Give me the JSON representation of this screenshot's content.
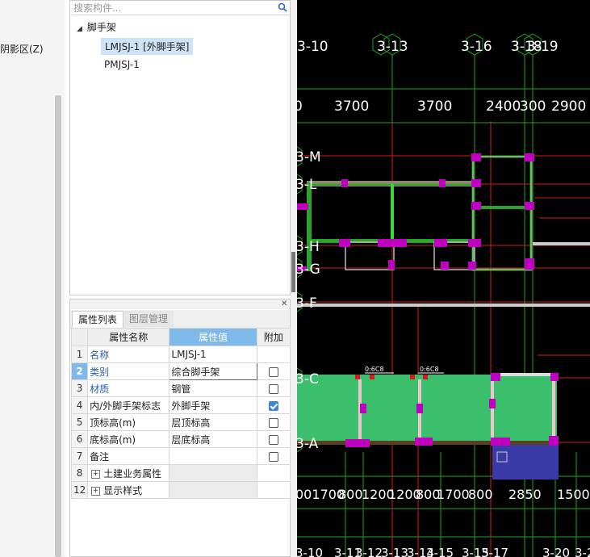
{
  "left_strip": {
    "clipped_label": "阴影区(Z)"
  },
  "tree": {
    "search_placeholder": "搜索构件...",
    "root_label": "脚手架",
    "items": [
      "LMJSJ-1 [外脚手架]",
      "PMJSJ-1"
    ]
  },
  "props": {
    "tabs": [
      "属性列表",
      "图层管理"
    ],
    "headers": {
      "name": "属性名称",
      "value": "属性值",
      "add": "附加"
    },
    "rows": [
      {
        "num": "1",
        "name": "名称",
        "value": "LMJSJ-1",
        "checkbox": null
      },
      {
        "num": "2",
        "name": "类别",
        "value": "综合脚手架",
        "checkbox": false
      },
      {
        "num": "3",
        "name": "材质",
        "value": "钢管",
        "checkbox": false
      },
      {
        "num": "4",
        "name": "内/外脚手架标志",
        "value": "外脚手架",
        "checkbox": true
      },
      {
        "num": "5",
        "name": "顶标高(m)",
        "value": "层顶标高",
        "checkbox": false
      },
      {
        "num": "6",
        "name": "底标高(m)",
        "value": "层底标高",
        "checkbox": false
      },
      {
        "num": "7",
        "name": "备注",
        "value": "",
        "checkbox": false
      },
      {
        "num": "8",
        "name": "土建业务属性",
        "value": "",
        "checkbox": null
      },
      {
        "num": "12",
        "name": "显示样式",
        "value": "",
        "checkbox": null
      }
    ]
  },
  "cad": {
    "top_axes": [
      "3-10",
      "3-13",
      "3-16",
      "3-18",
      "3-19"
    ],
    "top_dims": [
      "0",
      "3700",
      "3700",
      "2400",
      "300",
      "2900"
    ],
    "row_axes": [
      "3-M",
      "3-L",
      "3-H",
      "3-G",
      "3-F",
      "3-C",
      "3-A"
    ],
    "rebar_labels": [
      "0:6C8",
      "0:6C8"
    ],
    "bottom_dims": [
      "001700",
      "800",
      "1200",
      "1200",
      "800",
      "1700",
      "800",
      "2850",
      "1500"
    ],
    "bottom_axes": [
      "3-10",
      "3-11",
      "3-12",
      "3-13",
      "3-14",
      "3-15",
      "3-15",
      "3-17",
      "3-20",
      "3-2"
    ],
    "colors": {
      "axis": "#1fa51f",
      "text": "#ffffff",
      "red": "#d21b1b",
      "wall": "#c000c0",
      "slab": "#3cbf6c",
      "blue": "#3a3aa8"
    }
  }
}
